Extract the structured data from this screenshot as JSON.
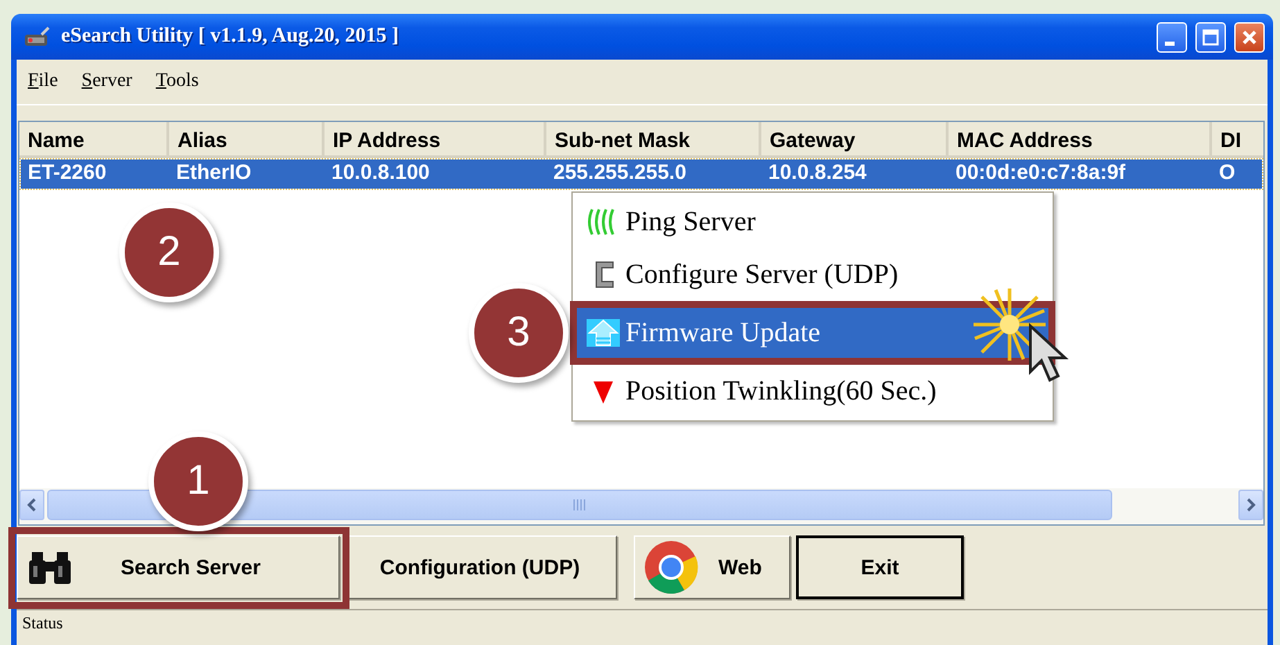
{
  "window": {
    "title": "eSearch Utility [ v1.1.9, Aug.20, 2015 ]"
  },
  "menu_bar": [
    {
      "label": "File"
    },
    {
      "label": "Server"
    },
    {
      "label": "Tools"
    }
  ],
  "table": {
    "columns": [
      "Name",
      "Alias",
      "IP Address",
      "Sub-net Mask",
      "Gateway",
      "MAC Address",
      "DI"
    ],
    "rows": [
      {
        "cells": [
          "ET-2260",
          "EtherIO",
          "10.0.8.100",
          "255.255.255.0",
          "10.0.8.254",
          "00:0d:e0:c7:8a:9f",
          "O"
        ],
        "selected": true
      }
    ]
  },
  "context_menu": {
    "items": [
      {
        "label": "Ping Server",
        "kind": "ping",
        "selected": false
      },
      {
        "label": "Configure Server (UDP)",
        "kind": "configure",
        "selected": false
      },
      {
        "label": "Firmware Update",
        "kind": "firmware",
        "selected": true
      },
      {
        "label": "Position Twinkling(60 Sec.)",
        "kind": "position",
        "selected": false
      }
    ]
  },
  "buttons": [
    {
      "label": "Search Server",
      "kind": "search",
      "focused": false
    },
    {
      "label": "Configuration (UDP)",
      "kind": "plain",
      "focused": false
    },
    {
      "label": "Web",
      "kind": "web",
      "focused": false
    },
    {
      "label": "Exit",
      "kind": "plain",
      "focused": true
    }
  ],
  "status_bar": {
    "text": "Status"
  },
  "callouts": [
    {
      "number": "1",
      "highlight": true
    },
    {
      "number": "2",
      "highlight": false
    },
    {
      "number": "3",
      "highlight": true
    }
  ]
}
